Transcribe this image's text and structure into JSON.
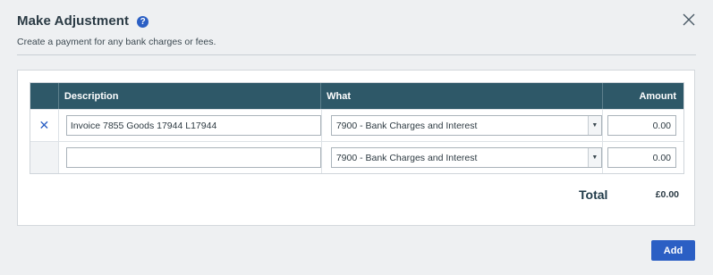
{
  "dialog": {
    "title": "Make Adjustment",
    "help_icon": "?",
    "subtitle": "Create a payment for any bank charges or fees."
  },
  "grid": {
    "columns": [
      "",
      "Description",
      "What",
      "Amount"
    ],
    "rows": [
      {
        "delete": "✕",
        "description": "Invoice 7855 Goods 17944 L17944",
        "what": "7900 - Bank Charges and Interest",
        "amount": "0.00"
      },
      {
        "delete": "",
        "description": "",
        "what": "7900 - Bank Charges and Interest",
        "amount": "0.00"
      }
    ]
  },
  "totals": {
    "label": "Total",
    "value": "£0.00"
  },
  "actions": {
    "add_label": "Add"
  },
  "icons": {
    "close": "close-icon",
    "help": "help-icon",
    "delete": "delete-row-icon",
    "dropdown": "chevron-down-icon"
  },
  "colors": {
    "accent": "#2b5fc4",
    "header_bg": "#2e5868"
  }
}
